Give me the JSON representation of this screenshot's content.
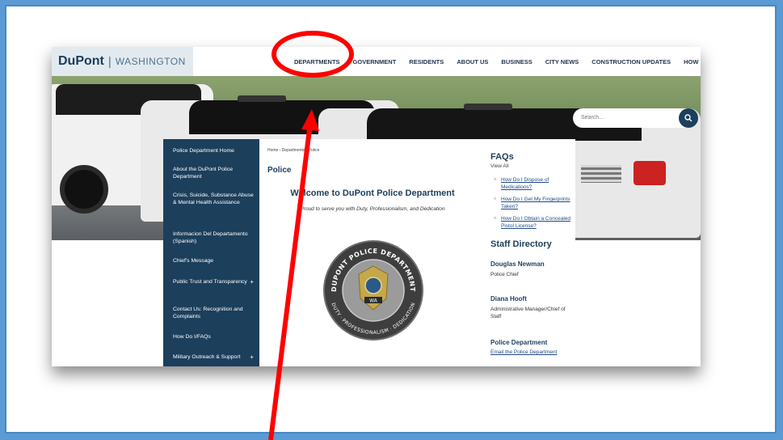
{
  "site": {
    "logo_main": "DuPont",
    "logo_sep": "|",
    "logo_state": "WASHINGTON"
  },
  "nav": [
    "DEPARTMENTS",
    "GOVERNMENT",
    "RESIDENTS",
    "ABOUT US",
    "BUSINESS",
    "CITY NEWS",
    "CONSTRUCTION UPDATES",
    "HOW DO I...?"
  ],
  "search": {
    "placeholder": "Search..."
  },
  "sidebar": {
    "items": [
      {
        "label": "Police Department Home"
      },
      {
        "label": "About the DuPont Police Department"
      },
      {
        "label": "Crisis, Suicide, Substance Abuse & Mental Health Assistance"
      },
      {
        "label": "Informacion Del Departamento (Spanish)"
      },
      {
        "label": "Chief's Message"
      },
      {
        "label": "Public Trust and Transparency",
        "expand": "+"
      },
      {
        "label": "Contact Us: Recognition and Complaints"
      },
      {
        "label": "How Do I/FAQs"
      },
      {
        "label": "Military Outreach & Support",
        "expand": "+"
      }
    ]
  },
  "main": {
    "breadcrumb": "Home › Departments › Police",
    "title": "Police",
    "welcome": "Welcome to DuPont Police Department",
    "tagline": "Proud to serve you with Duty, Professionalism, and Dedication",
    "seal": {
      "top_text": "DUPONT POLICE DEPARTMENT",
      "bottom_text": "DUTY · PROFESSIONALISM · DEDICATION",
      "badge_text": "WA"
    }
  },
  "faqs": {
    "heading": "FAQs",
    "view_all": "View All",
    "items": [
      {
        "text": "How Do I Dispose of Medications?"
      },
      {
        "text": "How Do I Get My Fingerprints Taken?"
      },
      {
        "text": "How Do I Obtain a Concealed Pistol License?"
      }
    ]
  },
  "staff": {
    "heading": "Staff Directory",
    "people": [
      {
        "name": "Douglas Newman",
        "role": "Police Chief"
      },
      {
        "name": "Diana Hooft",
        "role": "Administrative Manager/Chief of Staff"
      }
    ],
    "dept_heading": "Police Department",
    "email_link": "Email the Police Department"
  },
  "colors": {
    "navy": "#1c3f5c",
    "annotation": "#ff0000",
    "frame": "#5b9bd5"
  }
}
